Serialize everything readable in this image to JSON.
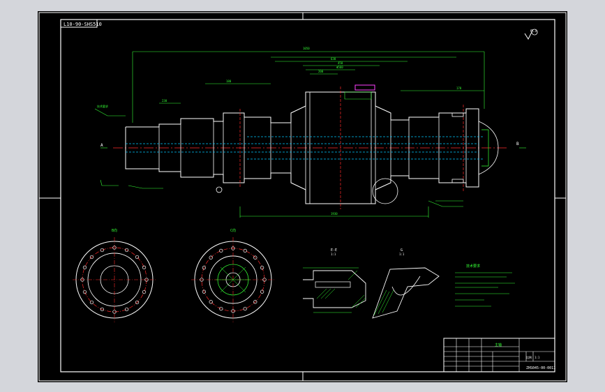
{
  "drawing": {
    "number_stamp": "L10-90-SHS510",
    "roughness_mark": "6.3",
    "title_block": {
      "title": "主轴",
      "drawing_no": "ZHS045-00-0011",
      "cells": [
        "比例",
        "1:1"
      ]
    },
    "section_labels": {
      "ee": "E-E",
      "ee_scale": "1:1",
      "g": "G",
      "g_scale": "1:1"
    },
    "view_labels": {
      "flange_left": "B向",
      "flange_right": "C向"
    },
    "notes_title": "技术要求",
    "colors": {
      "frame": "#ffffff",
      "geometry": "#ffffff",
      "dimension": "#35ff35",
      "centerline": "#ff2a2a",
      "hidden": "#00c8ff",
      "highlight": "#ff40ff"
    }
  }
}
